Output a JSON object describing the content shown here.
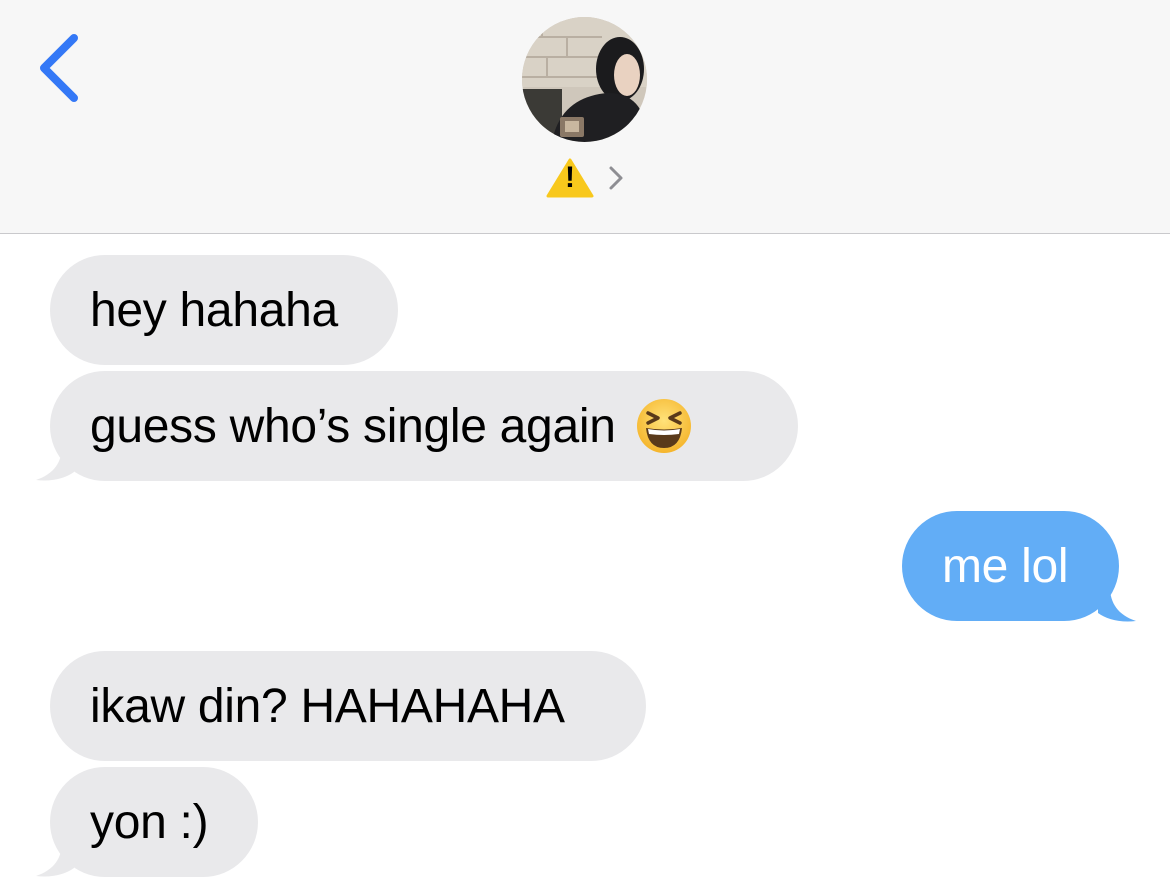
{
  "header": {
    "back_icon": "chevron-left-icon",
    "avatar": "contact-avatar-photo",
    "status_icon": "warning-icon",
    "detail_icon": "chevron-right-icon",
    "status_glyph": "!"
  },
  "colors": {
    "header_bg": "#f7f7f7",
    "accent": "#3478f6",
    "received_bubble": "#e9e9eb",
    "sent_bubble": "#62adf6",
    "warning": "#f8c81c"
  },
  "messages": [
    {
      "from": "them",
      "text": "hey hahaha"
    },
    {
      "from": "them",
      "text": "guess who’s single again",
      "emoji": "grinning-squinting-face-icon"
    },
    {
      "from": "me",
      "text": "me lol"
    },
    {
      "from": "them",
      "text": "ikaw din? HAHAHAHA"
    },
    {
      "from": "them",
      "text": "yon :)"
    }
  ]
}
